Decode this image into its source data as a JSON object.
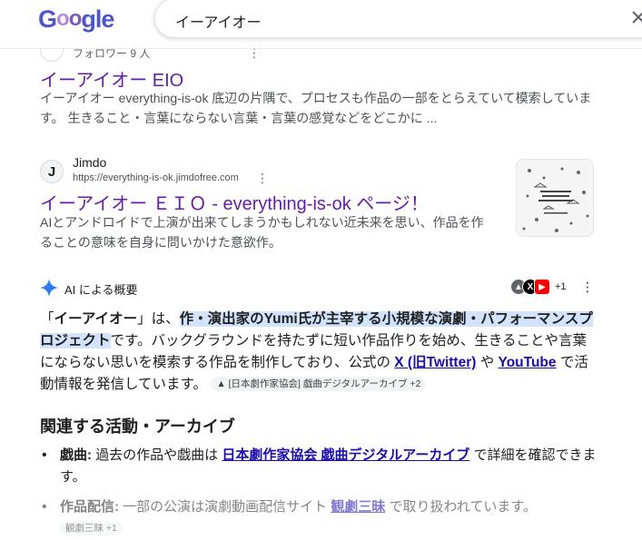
{
  "header": {
    "logo_letters": [
      "G",
      "o",
      "o",
      "gle"
    ],
    "search_query": "イーアイオー"
  },
  "result1": {
    "followers": "フォロワー 9 人",
    "title": "イーアイオー EIO",
    "snippet": "イーアイオー everything-is-ok 底辺の片隅で、プロセスも作品の一部をとらえていて模索しています。 生きること・言葉にならない言葉・言葉の感覚などをどこかに ..."
  },
  "result2": {
    "site_initial": "J",
    "site_name": "Jimdo",
    "url": "https://everything-is-ok.jimdofree.com",
    "title": "イーアイオー ＥＩＯ - everything-is-ok ページ！",
    "snippet": "AIとアンドロイドで上演が出来てしまうかもしれない近未来を思い、作品を作ることの意味を自身に問いかけた意欲作。"
  },
  "ai_overview": {
    "title": "AI による概要",
    "source_count": "+1",
    "p1": "「",
    "p1_term": "イーアイオー",
    "p1_b": "」は、",
    "p1_highlight": "作・演出家のYumi氏が主宰する小規模な演劇・パフォーマンスプロジェクト",
    "p1_c": "です。バックグラウンドを持たずに短い作品作りを始め、生きることや言葉にならない思いを模索する作品を制作しており、公式の ",
    "link_x": "X (旧Twitter)",
    "p1_d": " や ",
    "link_youtube": "YouTube",
    "p1_e": " で活動情報を発信しています。",
    "chip1": "[日本劇作家協会] 戯曲デジタルアーカイブ +2",
    "section_heading": "関連する活動・アーカイブ",
    "bullet1_label": "戯曲:",
    "bullet1_text": " 過去の作品や戯曲は ",
    "bullet1_link": "日本劇作家協会 戯曲デジタルアーカイブ",
    "bullet1_tail": " で詳細を確認できます。",
    "bullet2_label": "作品配信:",
    "bullet2_text": " 一部の公演は演劇動画配信サイト ",
    "bullet2_link": "観劇三昧",
    "bullet2_tail": " で取り扱われています。",
    "chip2": "観劇三昧 +1"
  },
  "colors": {
    "visited_link": "#681da8",
    "link": "#1a0dab",
    "highlight": "#d3e3fd"
  }
}
